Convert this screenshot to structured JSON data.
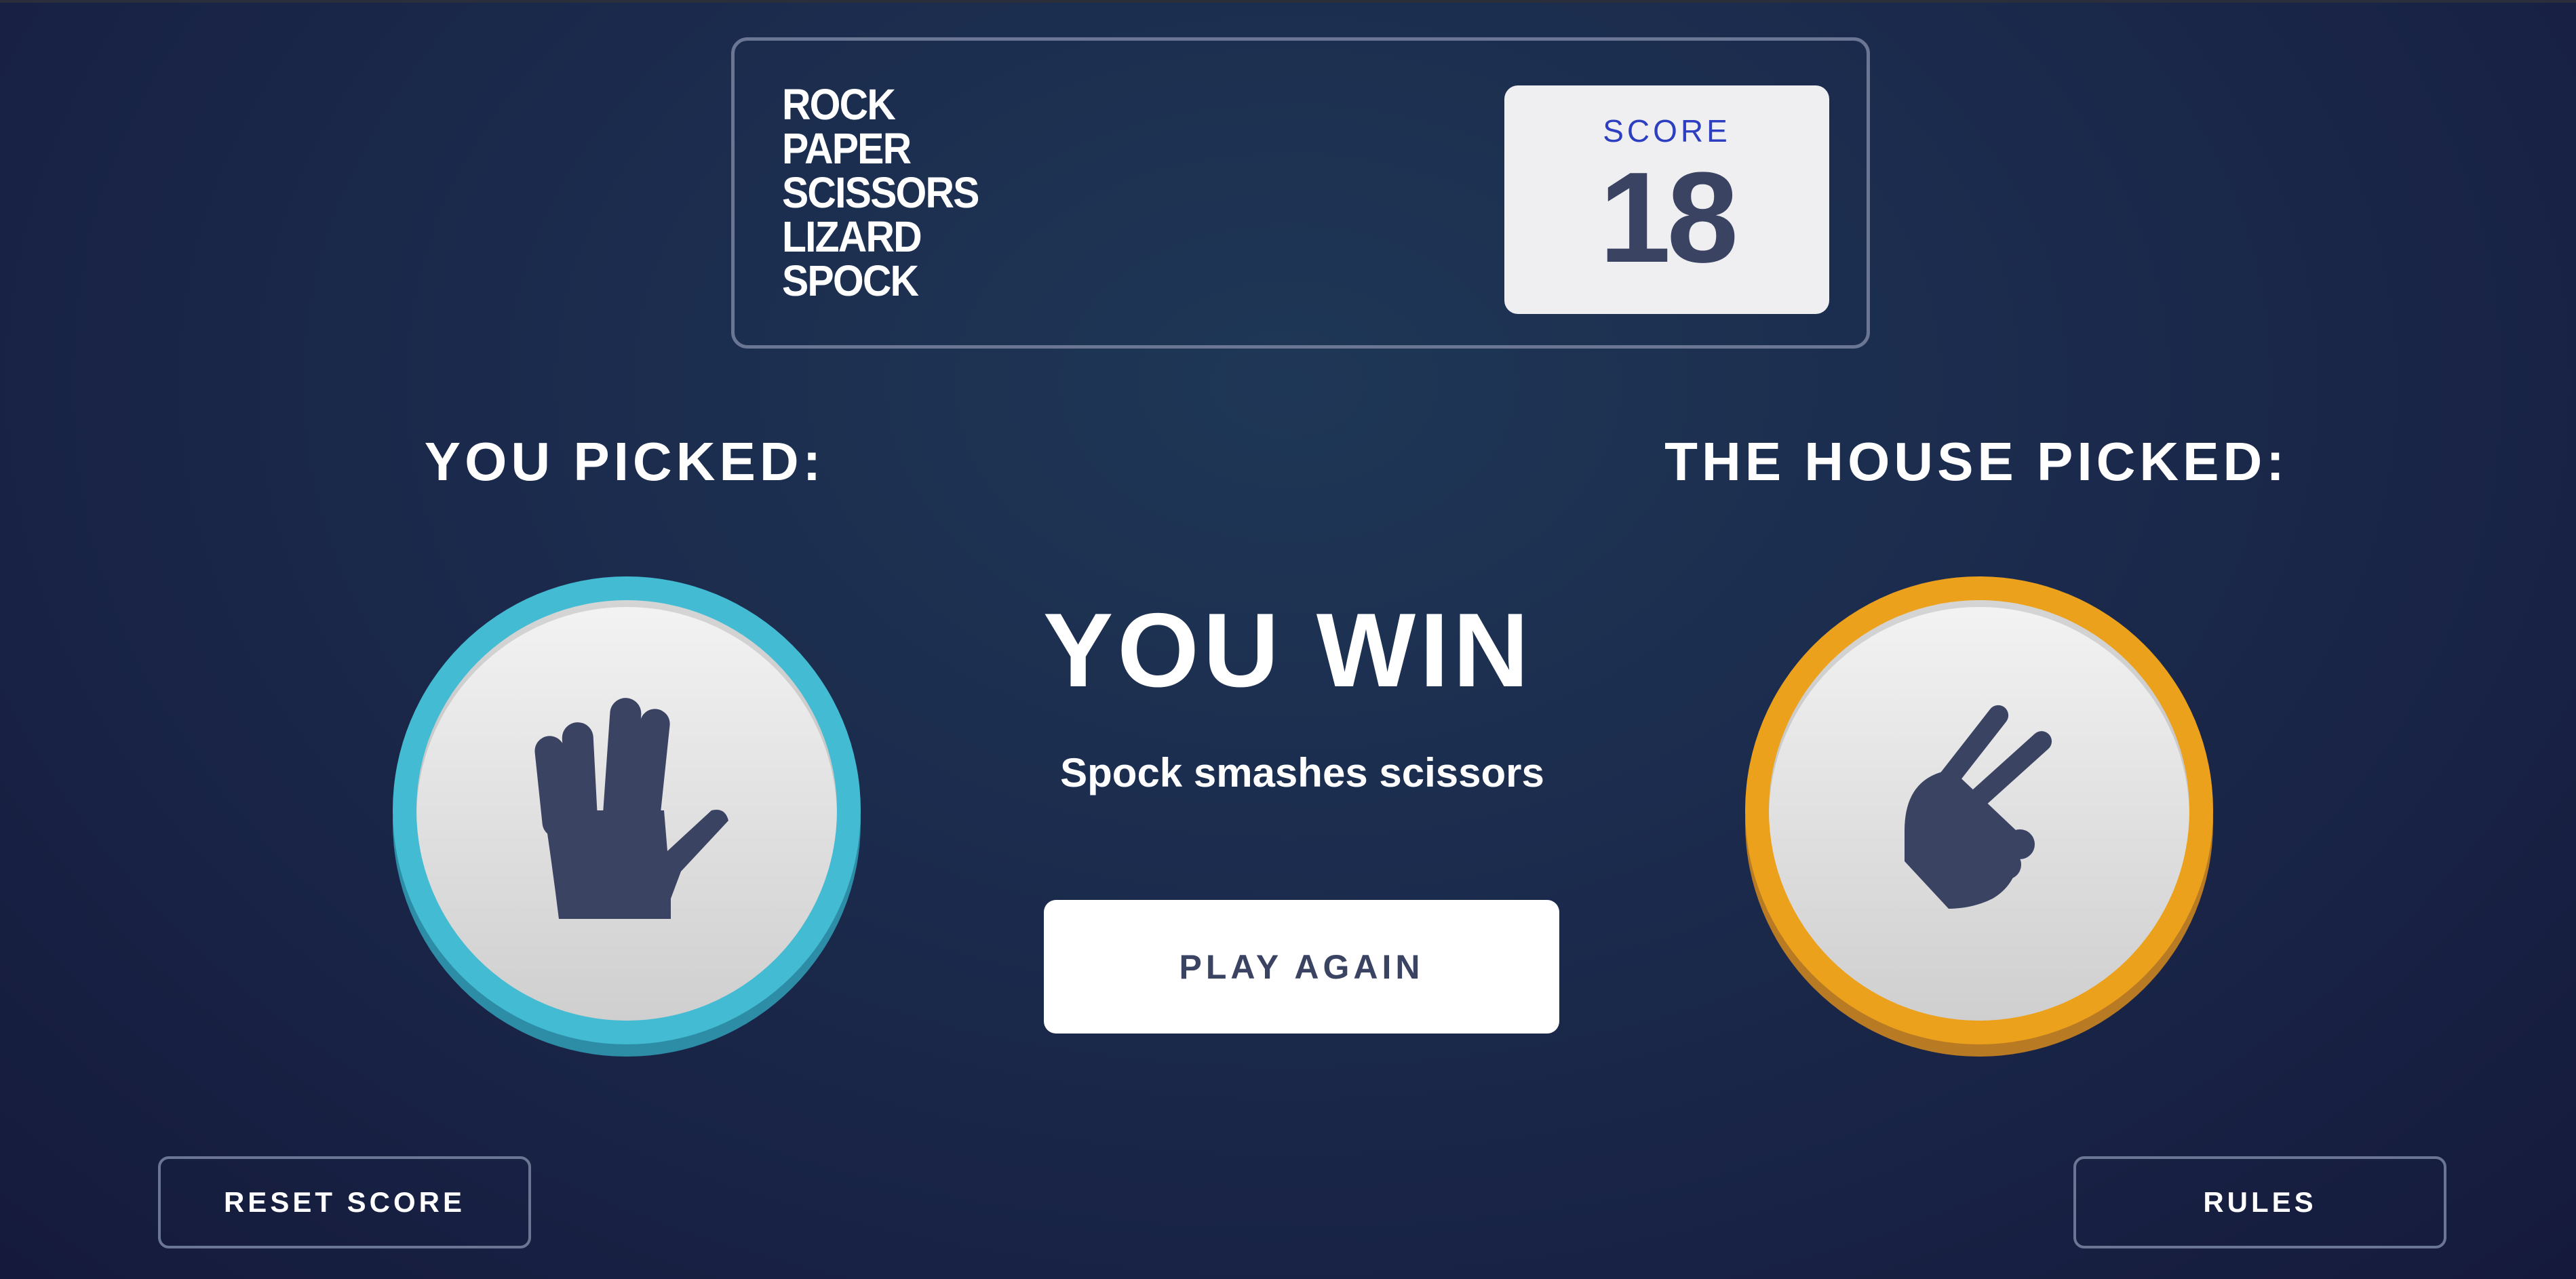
{
  "header": {
    "title_lines": [
      "ROCK",
      "PAPER",
      "SCISSORS",
      "LIZARD",
      "SPOCK"
    ],
    "score_label": "SCORE",
    "score_value": "18"
  },
  "players": {
    "you_label": "YOU PICKED:",
    "house_label": "THE HOUSE PICKED:",
    "you_choice": "spock",
    "house_choice": "scissors"
  },
  "result": {
    "headline": "YOU WIN",
    "message": "Spock smashes scissors",
    "play_again_label": "PLAY AGAIN"
  },
  "footer": {
    "reset_label": "RESET SCORE",
    "rules_label": "RULES"
  },
  "icons": {
    "you_icon": "spock-hand-icon",
    "house_icon": "scissors-hand-icon"
  },
  "colors": {
    "spock_ring": "#43bbd3",
    "scissors_ring": "#eca11d",
    "score_label": "#2d3fc0",
    "dark_text": "#3b4363"
  }
}
